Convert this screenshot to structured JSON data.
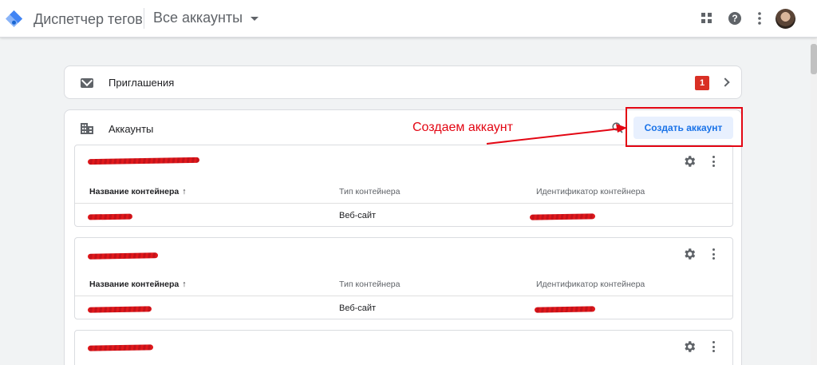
{
  "header": {
    "app_title": "Диспетчер тегов",
    "account_selector": "Все аккаунты",
    "icons": [
      "apps-grid-icon",
      "help-icon",
      "more-vert-icon",
      "avatar"
    ]
  },
  "invitations": {
    "label": "Приглашения",
    "count": "1"
  },
  "accounts": {
    "label": "Аккаунты",
    "create_button": "Создать аккаунт",
    "columns": [
      "Название контейнера",
      "Тип контейнера",
      "Идентификатор контейнера"
    ],
    "rows": [
      {
        "container_type": "Веб-сайт"
      },
      {
        "container_type": "Веб-сайт"
      }
    ]
  },
  "annotation": {
    "text": "Создаем аккаунт"
  },
  "colors": {
    "accent": "#1a73e8",
    "badge": "#d93025",
    "annotation": "#e30613",
    "redaction": "#e0181b"
  }
}
